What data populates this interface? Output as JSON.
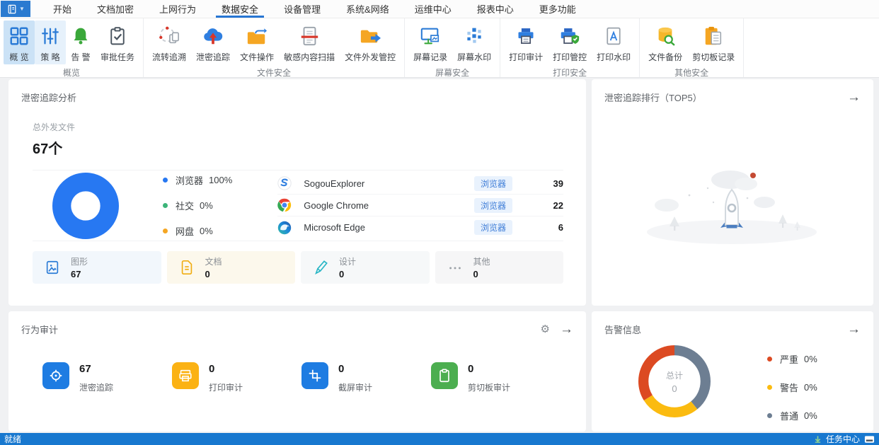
{
  "menubar": {
    "tabs": [
      {
        "label": "开始"
      },
      {
        "label": "文档加密"
      },
      {
        "label": "上网行为"
      },
      {
        "label": "数据安全",
        "active": true
      },
      {
        "label": "设备管理"
      },
      {
        "label": "系统&网络"
      },
      {
        "label": "运维中心"
      },
      {
        "label": "报表中心"
      },
      {
        "label": "更多功能"
      }
    ]
  },
  "ribbon": {
    "groups": [
      {
        "label": "概览",
        "items": [
          {
            "label": "概 览"
          },
          {
            "label": "策 略"
          },
          {
            "label": "告 警"
          },
          {
            "label": "审批任务"
          }
        ]
      },
      {
        "label": "文件安全",
        "items": [
          {
            "label": "流转追溯"
          },
          {
            "label": "泄密追踪"
          },
          {
            "label": "文件操作"
          },
          {
            "label": "敏感内容扫描"
          },
          {
            "label": "文件外发管控"
          }
        ]
      },
      {
        "label": "屏幕安全",
        "items": [
          {
            "label": "屏幕记录"
          },
          {
            "label": "屏幕水印"
          }
        ]
      },
      {
        "label": "打印安全",
        "items": [
          {
            "label": "打印审计"
          },
          {
            "label": "打印管控"
          },
          {
            "label": "打印水印"
          }
        ]
      },
      {
        "label": "其他安全",
        "items": [
          {
            "label": "文件备份"
          },
          {
            "label": "剪切板记录"
          }
        ]
      }
    ]
  },
  "panels": {
    "trace_analysis": {
      "title": "泄密追踪分析",
      "total_label": "总外发文件",
      "total_value": "67个",
      "donut": {
        "type": "donut",
        "segments": [
          {
            "label": "浏览器",
            "color": "#2778f2",
            "fraction": 1
          }
        ]
      },
      "legend": [
        {
          "label": "浏览器",
          "pct": "100%",
          "color": "#2778f2"
        },
        {
          "label": "社交",
          "pct": "0%",
          "color": "#3cb479"
        },
        {
          "label": "网盘",
          "pct": "0%",
          "color": "#f5a623"
        }
      ],
      "apps": [
        {
          "name": "SogouExplorer",
          "badge": "浏览器",
          "count": "39"
        },
        {
          "name": "Google Chrome",
          "badge": "浏览器",
          "count": "22"
        },
        {
          "name": "Microsoft Edge",
          "badge": "浏览器",
          "count": "6"
        }
      ],
      "categories": [
        {
          "label": "图形",
          "value": "67",
          "bg": "#f2f7fc"
        },
        {
          "label": "文档",
          "value": "0",
          "bg": "#fcf8ec"
        },
        {
          "label": "设计",
          "value": "0",
          "bg": "#f6f8f9"
        },
        {
          "label": "其他",
          "value": "0",
          "bg": "#f6f6f7"
        }
      ]
    },
    "trace_ranking": {
      "title": "泄密追踪排行（TOP5）"
    },
    "behavior_audit": {
      "title": "行为审计",
      "stats": [
        {
          "value": "67",
          "label": "泄密追踪",
          "color": "#1e7ce2"
        },
        {
          "value": "0",
          "label": "打印审计",
          "color": "#fbb214"
        },
        {
          "value": "0",
          "label": "截屏审计",
          "color": "#1e7ce2"
        },
        {
          "value": "0",
          "label": "剪切板审计",
          "color": "#4cae50"
        }
      ]
    },
    "alerts": {
      "title": "告警信息",
      "center_label": "总计",
      "center_value": "0",
      "donut": {
        "type": "donut",
        "segments": [
          {
            "label": "普通",
            "color": "#6d7e92",
            "fraction": 0.39
          },
          {
            "label": "警告",
            "color": "#fbbb10",
            "fraction": 0.27
          },
          {
            "label": "严重",
            "color": "#dc4a22",
            "fraction": 0.34
          }
        ]
      },
      "legend": [
        {
          "label": "严重",
          "pct": "0%",
          "color": "#dc4a22"
        },
        {
          "label": "警告",
          "pct": "0%",
          "color": "#fbbb10"
        },
        {
          "label": "普通",
          "pct": "0%",
          "color": "#6d7e92"
        }
      ]
    }
  },
  "statusbar": {
    "ready": "就绪",
    "task_center": "任务中心"
  }
}
